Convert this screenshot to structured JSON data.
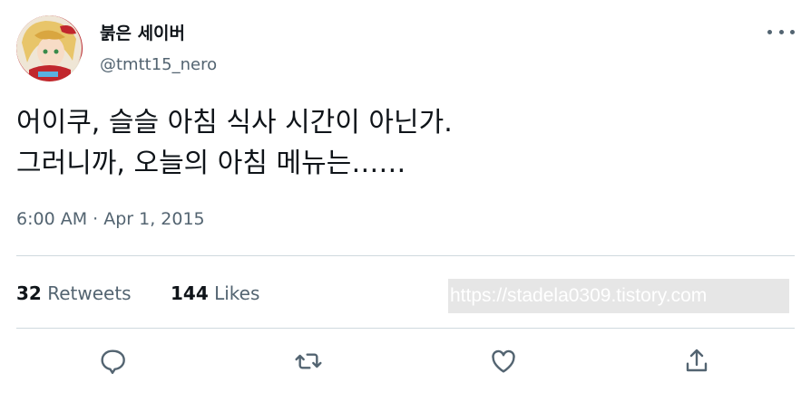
{
  "tweet": {
    "author": {
      "display_name": "붉은 세이버",
      "handle": "@tmtt15_nero"
    },
    "text_line1": "어이쿠, 슬슬 아침 식사 시간이 아닌가.",
    "text_line2": "그러니까, 오늘의 아침 메뉴는……",
    "timestamp": "6:00 AM · Apr 1, 2015",
    "stats": {
      "retweets_count": "32",
      "retweets_label": "Retweets",
      "likes_count": "144",
      "likes_label": "Likes"
    },
    "watermark": "https://stadela0309.tistory.com"
  },
  "icons": {
    "more": "more-horizontal-icon",
    "reply": "reply-icon",
    "retweet": "retweet-icon",
    "like": "heart-icon",
    "share": "share-icon"
  },
  "colors": {
    "text_primary": "#0f1419",
    "text_secondary": "#536471",
    "divider": "#cfd9de"
  }
}
